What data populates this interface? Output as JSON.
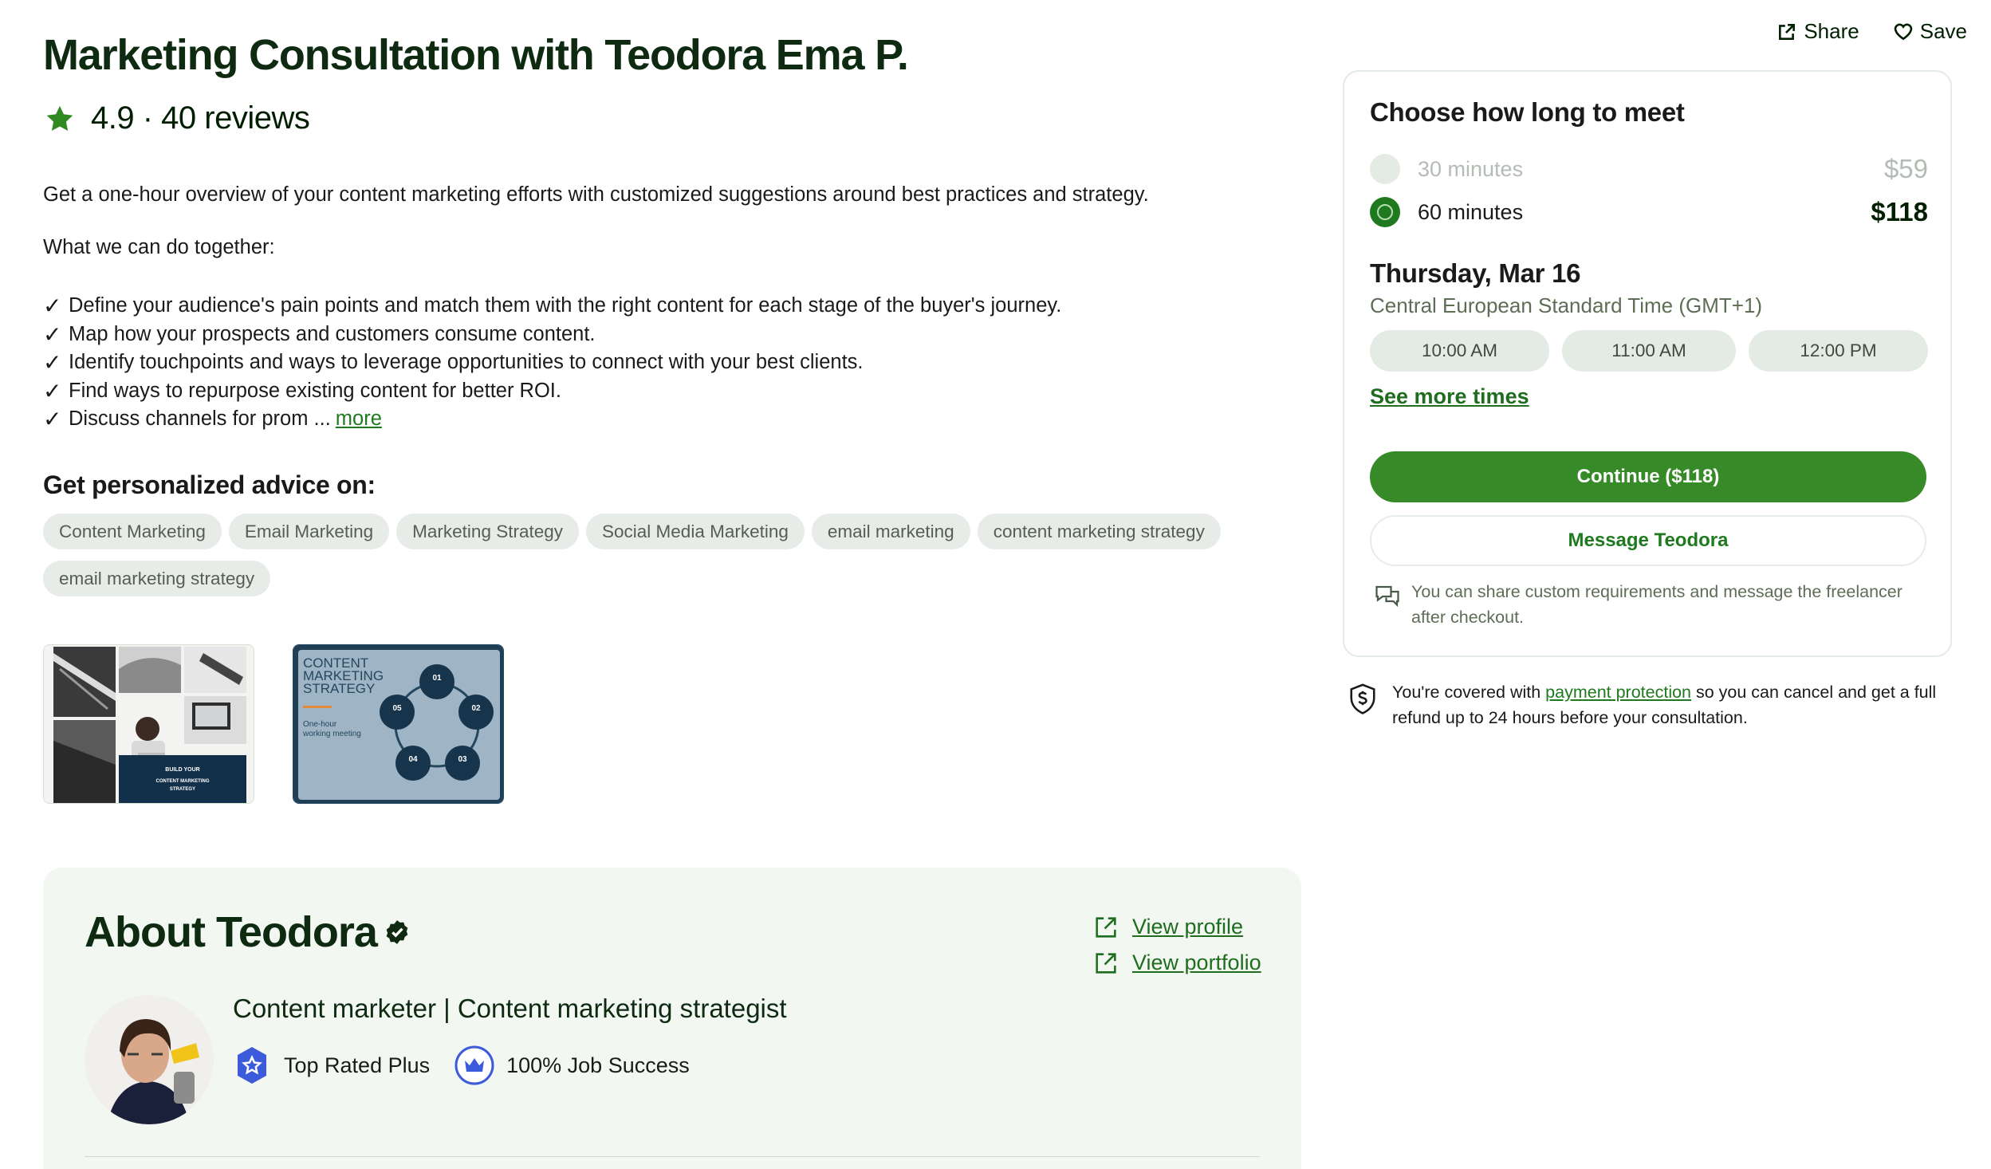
{
  "header": {
    "title": "Marketing Consultation with Teodora Ema P.",
    "rating": "4.9 · 40 reviews",
    "share_label": "Share",
    "save_label": "Save"
  },
  "description": {
    "intro": "Get a one-hour overview of your content marketing efforts with customized suggestions around best practices and strategy.",
    "what_heading": "What we can do together:",
    "bullets": [
      "Define your audience's pain points and match them with the right content for each stage of the buyer's journey.",
      "Map how your prospects and customers consume content.",
      "Identify touchpoints and ways to leverage opportunities to connect with your best clients.",
      "Find ways to repurpose existing content for better ROI.",
      "Discuss channels for prom ..."
    ],
    "more_label": "more"
  },
  "advice": {
    "heading": "Get personalized advice on:",
    "tags": [
      "Content Marketing",
      "Email Marketing",
      "Marketing Strategy",
      "Social Media Marketing",
      "email marketing",
      "content marketing strategy",
      "email marketing strategy"
    ]
  },
  "thumbnails": {
    "thumb1_caption": "BUILD YOUR CONTENT MARKETING STRATEGY",
    "thumb2_title": "CONTENT MARKETING STRATEGY",
    "thumb2_subtitle": "One-hour working meeting",
    "thumb2_steps": [
      "01",
      "02",
      "03",
      "04",
      "05"
    ]
  },
  "about": {
    "heading": "About Teodora",
    "view_profile": "View profile",
    "view_portfolio": "View portfolio",
    "headline": "Content marketer | Content marketing strategist",
    "badge_top_rated": "Top Rated Plus",
    "badge_job_success": "100% Job Success"
  },
  "booking": {
    "heading": "Choose how long to meet",
    "options": [
      {
        "label": "30 minutes",
        "price": "$59",
        "selected": false
      },
      {
        "label": "60 minutes",
        "price": "$118",
        "selected": true
      }
    ],
    "date": "Thursday, Mar 16",
    "timezone": "Central European Standard Time (GMT+1)",
    "slots": [
      "10:00 AM",
      "11:00 AM",
      "12:00 PM"
    ],
    "see_more": "See more times",
    "continue_label": "Continue ($118)",
    "message_label": "Message Teodora",
    "note": "You can share custom requirements and message the freelancer after checkout."
  },
  "protection": {
    "prefix": "You're covered with ",
    "link": "payment protection",
    "suffix": " so you can cancel and get a full refund up to 24 hours before your consultation."
  },
  "colors": {
    "brand_green": "#368a27",
    "link_green": "#1f7a1f",
    "tag_bg": "#e8ece8",
    "about_bg": "#f2f7f2"
  }
}
